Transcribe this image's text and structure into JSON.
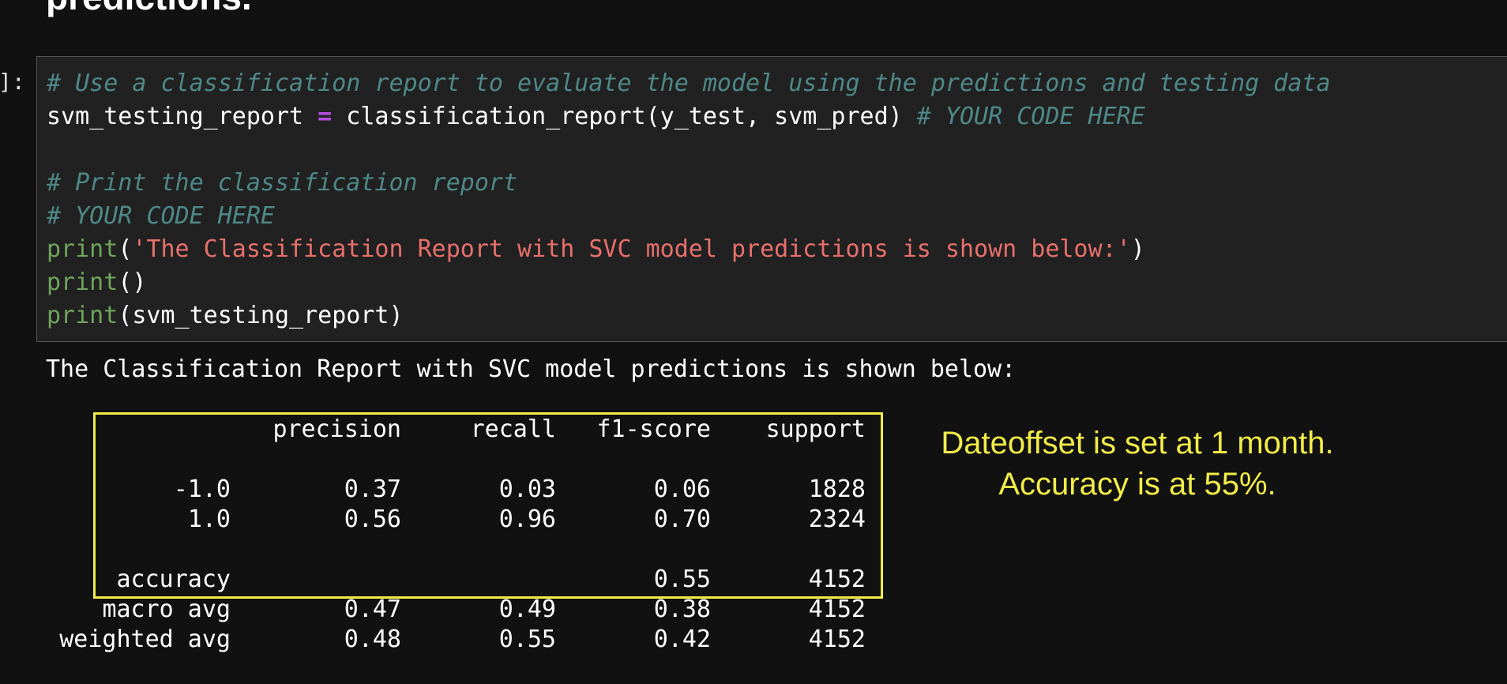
{
  "heading": "predictions.",
  "prompt": "]:",
  "code_lines": [
    [
      {
        "cls": "cmt",
        "text": "# Use a classification report to evaluate the model using the predictions and testing data"
      }
    ],
    [
      {
        "cls": "txt",
        "text": "svm_testing_report "
      },
      {
        "cls": "op",
        "text": "="
      },
      {
        "cls": "txt",
        "text": " classification_report(y_test, svm_pred) "
      },
      {
        "cls": "cmt",
        "text": "# YOUR CODE HERE"
      }
    ],
    [],
    [
      {
        "cls": "cmt",
        "text": "# Print the classification report"
      }
    ],
    [
      {
        "cls": "cmt",
        "text": "# YOUR CODE HERE"
      }
    ],
    [
      {
        "cls": "fn",
        "text": "print"
      },
      {
        "cls": "txt",
        "text": "("
      },
      {
        "cls": "str",
        "text": "'The Classification Report with SVC model predictions is shown below:'"
      },
      {
        "cls": "txt",
        "text": ")"
      }
    ],
    [
      {
        "cls": "fn",
        "text": "print"
      },
      {
        "cls": "txt",
        "text": "()"
      }
    ],
    [
      {
        "cls": "fn",
        "text": "print"
      },
      {
        "cls": "txt",
        "text": "(svm_testing_report)"
      }
    ]
  ],
  "output": {
    "title": "The Classification Report with SVC model predictions is shown below:",
    "headers": [
      "precision",
      "recall",
      "f1-score",
      "support"
    ],
    "rows": [
      {
        "label": "-1.0",
        "precision": "0.37",
        "recall": "0.03",
        "f1": "0.06",
        "support": "1828"
      },
      {
        "label": "1.0",
        "precision": "0.56",
        "recall": "0.96",
        "f1": "0.70",
        "support": "2324"
      },
      {
        "label": "accuracy",
        "precision": "",
        "recall": "",
        "f1": "0.55",
        "support": "4152"
      },
      {
        "label": "macro avg",
        "precision": "0.47",
        "recall": "0.49",
        "f1": "0.38",
        "support": "4152"
      },
      {
        "label": "weighted avg",
        "precision": "0.48",
        "recall": "0.55",
        "f1": "0.42",
        "support": "4152"
      }
    ]
  },
  "annotation": {
    "line1": "Dateoffset is set at 1 month.",
    "line2": "Accuracy is at 55%.",
    "color": "#f2ec48"
  },
  "colors": {
    "background": "#111111",
    "code_cell_bg": "#212121",
    "comment": "#4f8888",
    "operator": "#b94ee6",
    "builtin": "#6fa55c",
    "string": "#e8706c",
    "highlight": "#f2ec48"
  }
}
